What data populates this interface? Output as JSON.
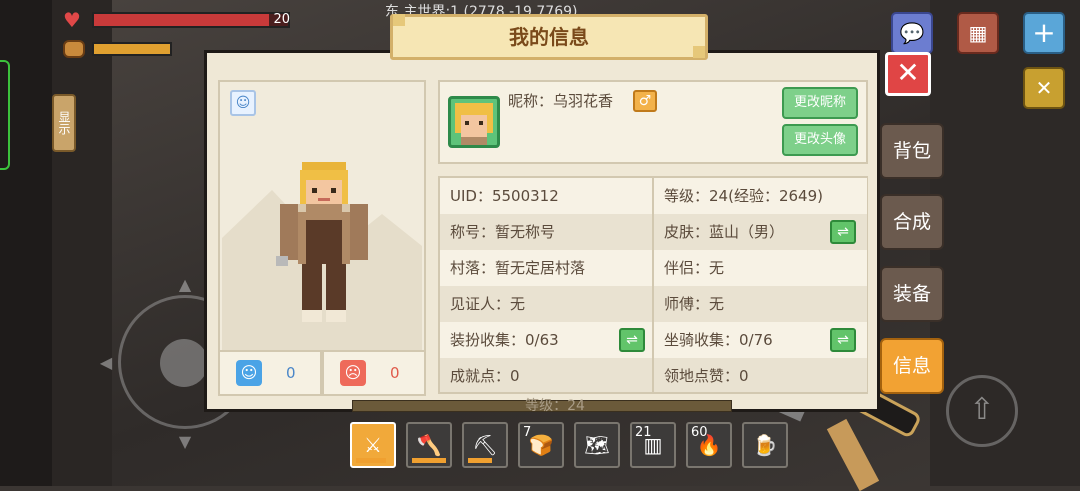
{
  "hud": {
    "health_value": "20",
    "health_fraction": 0.9,
    "hunger_fraction": 1.0,
    "coords_text": "东 主世界:1 (2778,-19,7769)",
    "show_tab_label": "显示"
  },
  "panel": {
    "title": "我的信息",
    "nickname": "昵称：乌羽花香",
    "gender_icon": "♂",
    "change_nickname_label": "更改昵称",
    "change_avatar_label": "更改头像",
    "like_blue_count": "0",
    "like_red_count": "0"
  },
  "info": {
    "left": [
      {
        "text": "UID：5500312"
      },
      {
        "text": "称号：暂无称号"
      },
      {
        "text": "村落：暂无定居村落"
      },
      {
        "text": "见证人：无"
      },
      {
        "text": "装扮收集：0/63"
      },
      {
        "text": "成就点：0"
      }
    ],
    "right": [
      {
        "text": "等级：24(经验：2649)"
      },
      {
        "text": "皮肤：蓝山（男）"
      },
      {
        "text": "伴侣：无"
      },
      {
        "text": "师傅：无"
      },
      {
        "text": "坐骑收集：0/76"
      },
      {
        "text": "领地点赞：0"
      }
    ]
  },
  "side_menu": {
    "backpack": "背包",
    "craft": "合成",
    "equip": "装备",
    "info": "信息"
  },
  "hotbar": {
    "level_text": "等级：24",
    "slots": [
      {
        "icon": "sword-icon",
        "count": ""
      },
      {
        "icon": "axe-icon",
        "count": ""
      },
      {
        "icon": "pickaxe-icon",
        "count": ""
      },
      {
        "icon": "bread-icon",
        "count": "7"
      },
      {
        "icon": "map-icon",
        "count": ""
      },
      {
        "icon": "wood-block-icon",
        "count": "21"
      },
      {
        "icon": "torch-icon",
        "count": "60"
      },
      {
        "icon": "mug-icon",
        "count": ""
      }
    ]
  },
  "colors": {
    "accent_orange": "#f2a233",
    "green_button": "#7ed08a",
    "close_red": "#e04545",
    "panel_bg": "#efe8d6"
  }
}
